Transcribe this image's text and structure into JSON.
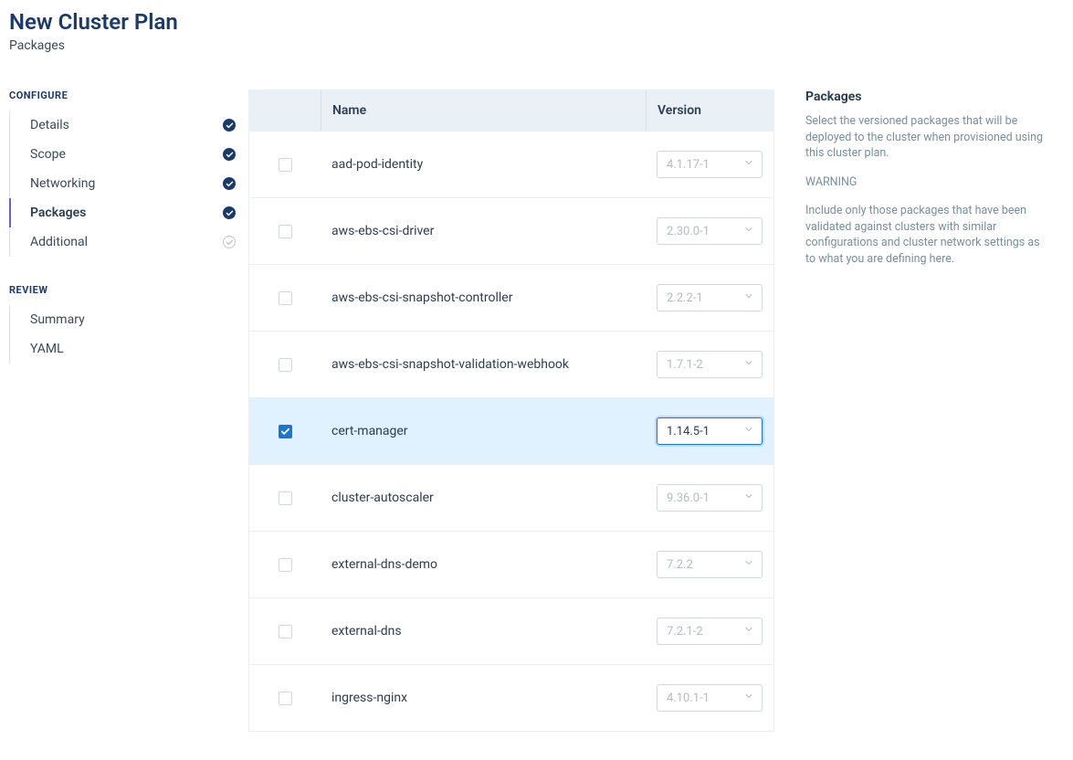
{
  "header": {
    "title": "New Cluster Plan",
    "subtitle": "Packages"
  },
  "sidebar": {
    "configure_label": "CONFIGURE",
    "review_label": "REVIEW",
    "configure_items": [
      {
        "label": "Details",
        "status": "done",
        "active": false
      },
      {
        "label": "Scope",
        "status": "done",
        "active": false
      },
      {
        "label": "Networking",
        "status": "done",
        "active": false
      },
      {
        "label": "Packages",
        "status": "done",
        "active": true
      },
      {
        "label": "Additional",
        "status": "pending",
        "active": false
      }
    ],
    "review_items": [
      {
        "label": "Summary"
      },
      {
        "label": "YAML"
      }
    ]
  },
  "table": {
    "header_name": "Name",
    "header_version": "Version",
    "rows": [
      {
        "name": "aad-pod-identity",
        "version_placeholder": "4.1.17-1",
        "selected": false
      },
      {
        "name": "aws-ebs-csi-driver",
        "version_placeholder": "2.30.0-1",
        "selected": false
      },
      {
        "name": "aws-ebs-csi-snapshot-controller",
        "version_placeholder": "2.2.2-1",
        "selected": false
      },
      {
        "name": "aws-ebs-csi-snapshot-validation-webhook",
        "version_placeholder": "1.7.1-2",
        "selected": false
      },
      {
        "name": "cert-manager",
        "version_value": "1.14.5-1",
        "selected": true
      },
      {
        "name": "cluster-autoscaler",
        "version_placeholder": "9.36.0-1",
        "selected": false
      },
      {
        "name": "external-dns-demo",
        "version_placeholder": "7.2.2",
        "selected": false
      },
      {
        "name": "external-dns",
        "version_placeholder": "7.2.1-2",
        "selected": false
      },
      {
        "name": "ingress-nginx",
        "version_placeholder": "4.10.1-1",
        "selected": false
      }
    ]
  },
  "rightpanel": {
    "title": "Packages",
    "desc": "Select the versioned packages that will be deployed to the cluster when provisioned using this cluster plan.",
    "warning_label": "WARNING",
    "warning_text": "Include only those packages that have been validated against clusters with similar configurations and cluster network settings as to what you are defining here."
  }
}
